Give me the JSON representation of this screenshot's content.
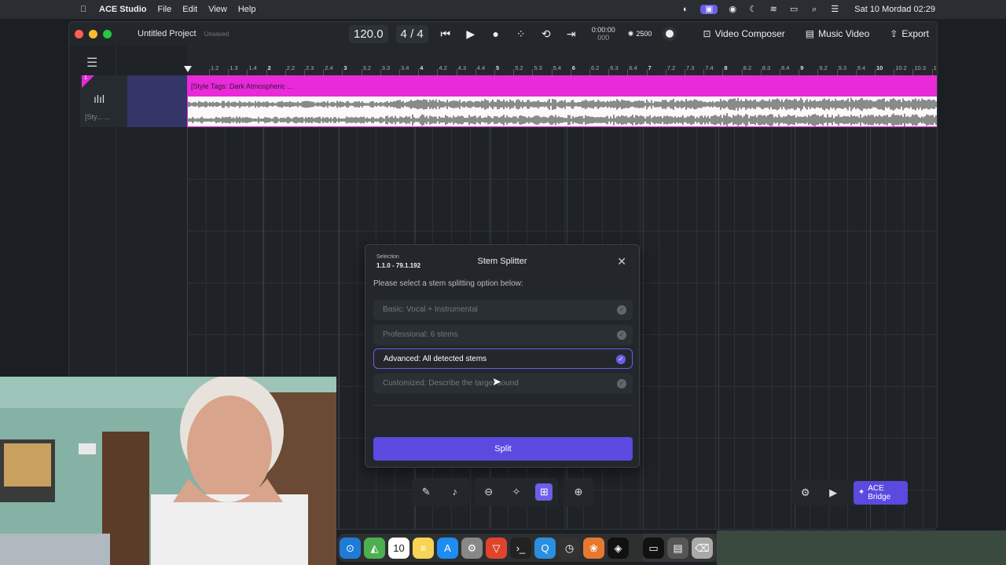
{
  "menubar": {
    "app_name": "ACE Studio",
    "menus": [
      "File",
      "Edit",
      "View",
      "Help"
    ],
    "clock": "Sat 10 Mordad  02:29"
  },
  "titlebar": {
    "project_title": "Untitled Project",
    "status": "Unsaved",
    "tempo": "120.0",
    "time_sig_num": "4",
    "time_sig_sep": "/",
    "time_sig_den": "4",
    "timecode": "0:00:00",
    "timecode_sub": "000",
    "credits": "2500",
    "video_composer": "Video Composer",
    "music_video": "Music Video",
    "export": "Export"
  },
  "track": {
    "number": "1",
    "name": "[Sty... ..."
  },
  "ruler": {
    "labels": [
      "1.2",
      "1.3",
      "1.4",
      "2",
      "2.2",
      "2.3",
      "2.4",
      "3",
      "3.2",
      "3.3",
      "3.4",
      "4",
      "4.2",
      "4.3",
      "4.4",
      "5",
      "5.2",
      "5.3",
      "5.4",
      "6",
      "6.2",
      "6.3",
      "6.4",
      "7",
      "7.2",
      "7.3",
      "7.4",
      "8",
      "8.2",
      "8.3",
      "8.4",
      "9",
      "9.2",
      "9.3",
      "9.4",
      "10",
      "10.2",
      "10.3",
      "10.4"
    ]
  },
  "clip": {
    "title": "[Style Tags: Dark Atmospheric ..."
  },
  "dialog": {
    "selection_label": "Selection",
    "selection_value": "1.1.0 - 79.1.192",
    "title": "Stem Splitter",
    "close": "✕",
    "prompt": "Please select a stem splitting option below:",
    "options": [
      {
        "label": "Basic: Vocal + Instrumental",
        "selected": false
      },
      {
        "label": "Professional: 6 stems",
        "selected": false
      },
      {
        "label": "Advanced: All detected stems",
        "selected": true
      },
      {
        "label": "Customized: Describe the target sound",
        "selected": false
      }
    ],
    "split_label": "Split"
  },
  "right_tools": {
    "ace_bridge": "ACE Bridge"
  },
  "dock": {
    "calendar_day": "10"
  },
  "colors": {
    "accent": "#6b5ee8",
    "clip_pink": "#e82ad8",
    "split_button": "#5a4ae0"
  }
}
